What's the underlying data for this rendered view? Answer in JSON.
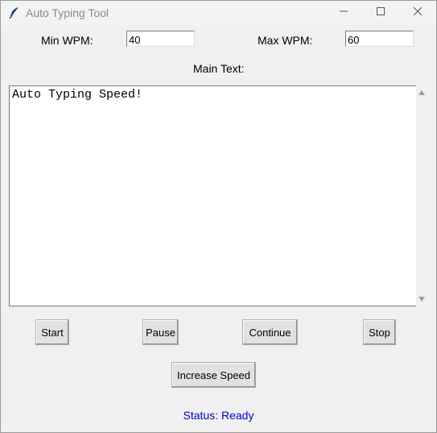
{
  "window": {
    "title": "Auto Typing Tool"
  },
  "icons": {
    "app": "feather-icon",
    "minimize": "minimize-icon",
    "maximize": "maximize-icon",
    "close": "close-icon"
  },
  "settings": {
    "min_wpm_label": "Min WPM:",
    "min_wpm_value": "40",
    "max_wpm_label": "Max WPM:",
    "max_wpm_value": "60"
  },
  "main_text": {
    "label": "Main Text:",
    "value": "Auto Typing Speed!"
  },
  "buttons": {
    "start": "Start",
    "pause": "Pause",
    "continue": "Continue",
    "stop": "Stop",
    "increase_speed": "Increase Speed"
  },
  "status": {
    "text": "Status: Ready",
    "color": "#0000cc"
  }
}
